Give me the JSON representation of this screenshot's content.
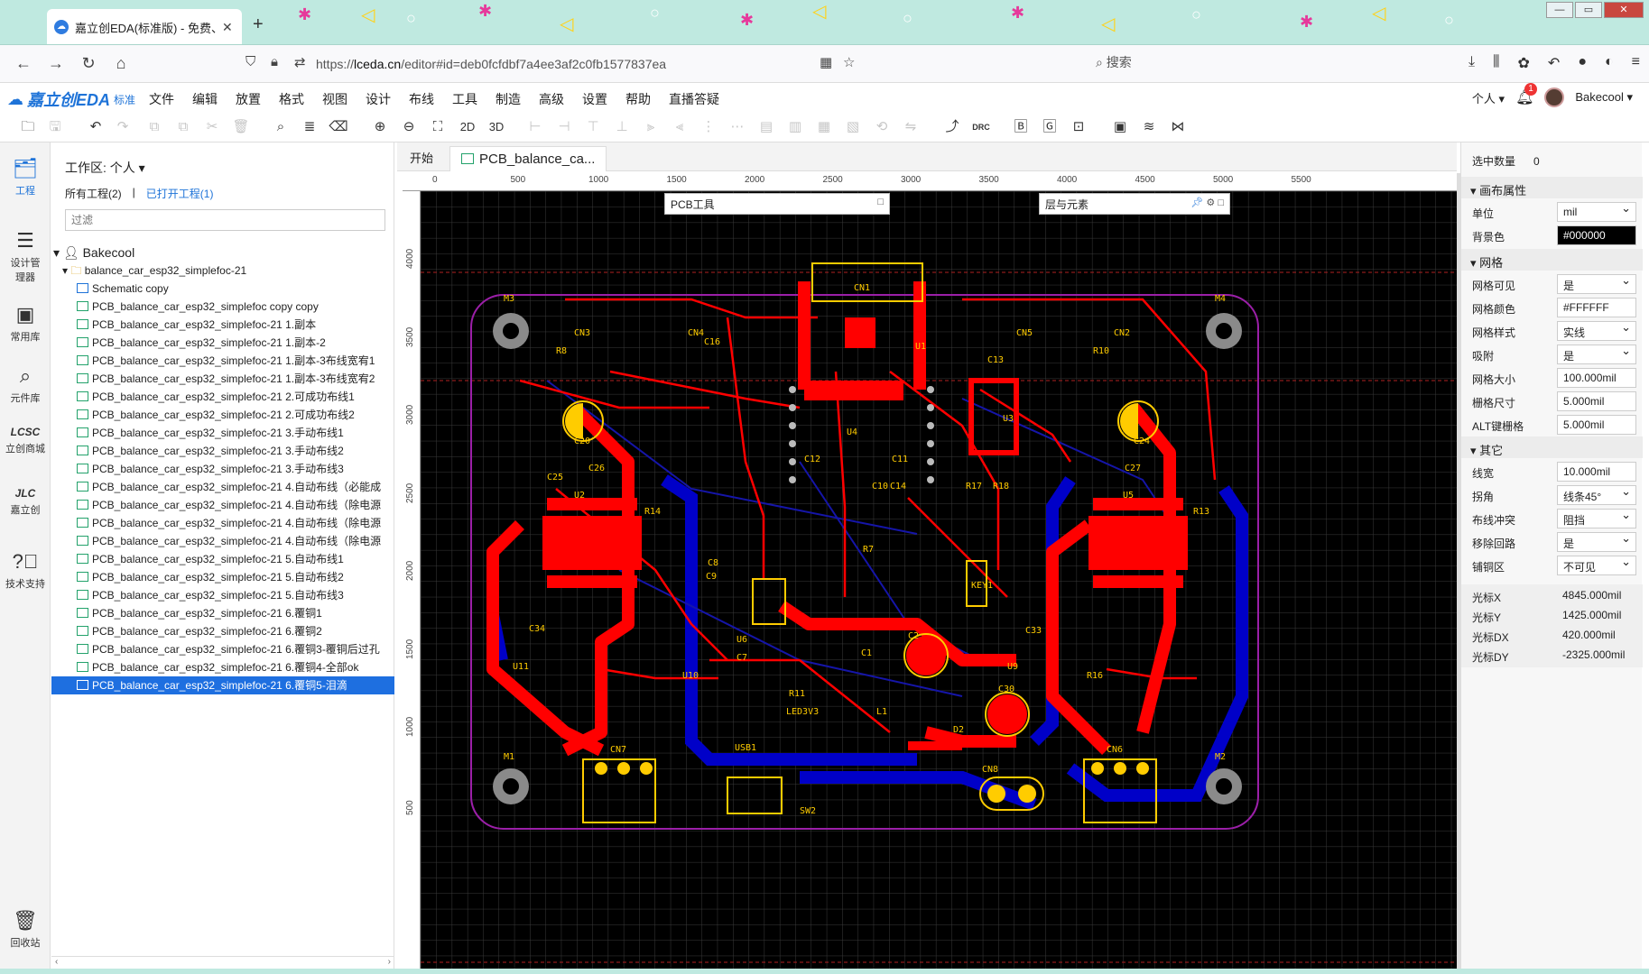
{
  "browser": {
    "tab_title": "嘉立创EDA(标准版) - 免费、易",
    "new_tab": "+",
    "url_prefix": "https://",
    "url_host": "lceda.cn",
    "url_path": "/editor#id=deb0fcfdbf7a4ee3af2c0fb1577837ea",
    "search_placeholder": "搜索",
    "window_controls": [
      "—",
      "▭",
      "✕"
    ]
  },
  "app": {
    "logo_text": "嘉立创EDA",
    "edition": "标准",
    "menus": [
      "文件",
      "编辑",
      "放置",
      "格式",
      "视图",
      "设计",
      "布线",
      "工具",
      "制造",
      "高级",
      "设置",
      "帮助",
      "直播答疑"
    ],
    "user_menu": "个人",
    "notification_count": "1",
    "username": "Bakecool"
  },
  "toolbar": {
    "btn_2d": "2D",
    "btn_3d": "3D",
    "btn_drc": "DRC"
  },
  "iconbar": [
    {
      "label": "工程",
      "icon": "folder-icon"
    },
    {
      "label": "设计管理器",
      "icon": "list-icon"
    },
    {
      "label": "常用库",
      "icon": "chip-icon"
    },
    {
      "label": "元件库",
      "icon": "search-icon"
    },
    {
      "label": "立创商城",
      "icon": "lcsc-icon"
    },
    {
      "label": "嘉立创",
      "icon": "jlc-icon"
    },
    {
      "label": "技术支持",
      "icon": "help-icon"
    },
    {
      "label": "回收站",
      "icon": "trash-icon"
    }
  ],
  "workspace": {
    "title": "工作区: 个人",
    "all_projects": "所有工程(2)",
    "separator": "|",
    "open_projects": "已打开工程(1)",
    "filter_placeholder": "过滤",
    "user": "Bakecool",
    "project": "balance_car_esp32_simplefoc-21",
    "files": [
      "Schematic copy",
      "PCB_balance_car_esp32_simplefoc copy copy",
      "PCB_balance_car_esp32_simplefoc-21 1.副本",
      "PCB_balance_car_esp32_simplefoc-21 1.副本-2",
      "PCB_balance_car_esp32_simplefoc-21 1.副本-3布线宽宥1",
      "PCB_balance_car_esp32_simplefoc-21 1.副本-3布线宽宥2",
      "PCB_balance_car_esp32_simplefoc-21 2.可成功布线1",
      "PCB_balance_car_esp32_simplefoc-21 2.可成功布线2",
      "PCB_balance_car_esp32_simplefoc-21 3.手动布线1",
      "PCB_balance_car_esp32_simplefoc-21 3.手动布线2",
      "PCB_balance_car_esp32_simplefoc-21 3.手动布线3",
      "PCB_balance_car_esp32_simplefoc-21 4.自动布线（必能成",
      "PCB_balance_car_esp32_simplefoc-21 4.自动布线（除电源",
      "PCB_balance_car_esp32_simplefoc-21 4.自动布线（除电源",
      "PCB_balance_car_esp32_simplefoc-21 4.自动布线（除电源",
      "PCB_balance_car_esp32_simplefoc-21 5.自动布线1",
      "PCB_balance_car_esp32_simplefoc-21 5.自动布线2",
      "PCB_balance_car_esp32_simplefoc-21 5.自动布线3",
      "PCB_balance_car_esp32_simplefoc-21 6.覆铜1",
      "PCB_balance_car_esp32_simplefoc-21 6.覆铜2",
      "PCB_balance_car_esp32_simplefoc-21 6.覆铜3-覆铜后过孔",
      "PCB_balance_car_esp32_simplefoc-21 6.覆铜4-全部ok",
      "PCB_balance_car_esp32_simplefoc-21 6.覆铜5-泪滴"
    ],
    "selected_file": "PCB_balance_car_esp32_simplefoc-21 6.覆铜5-泪滴"
  },
  "editor": {
    "tabs": [
      "开始",
      "PCB_balance_ca..."
    ],
    "ruler_top": [
      "0",
      "500",
      "1000",
      "1500",
      "2000",
      "2500",
      "3000",
      "3500",
      "4000",
      "4500",
      "5000",
      "5500"
    ],
    "ruler_left": [
      "4000",
      "3500",
      "3000",
      "2500",
      "2000",
      "1500",
      "1000",
      "500"
    ],
    "pcb_tools_title": "PCB工具",
    "layers_title": "层与元素",
    "designators": [
      "M3",
      "M4",
      "M1",
      "M2",
      "CN1",
      "CN2",
      "CN3",
      "CN4",
      "CN5",
      "CN6",
      "CN7",
      "CN8",
      "U1",
      "U2",
      "U3",
      "U4",
      "U5",
      "U6",
      "U9",
      "U10",
      "U11",
      "C1",
      "C2",
      "C7",
      "C8",
      "C9",
      "C10",
      "C11",
      "C12",
      "C13",
      "C14",
      "C16",
      "C20",
      "C24",
      "C25",
      "C26",
      "C27",
      "C30",
      "C33",
      "C34",
      "R7",
      "R8",
      "R10",
      "R11",
      "R13",
      "R14",
      "R16",
      "R17",
      "R18",
      "KEY1",
      "USB1",
      "SW2",
      "LED3V3",
      "L1",
      "D2"
    ]
  },
  "properties": {
    "selection_label": "选中数量",
    "selection_count": "0",
    "canvas_section": "画布属性",
    "unit_label": "单位",
    "unit_value": "mil",
    "bg_label": "背景色",
    "bg_value": "#000000",
    "grid_section": "网格",
    "grid_visible_label": "网格可见",
    "grid_visible_value": "是",
    "grid_color_label": "网格颜色",
    "grid_color_value": "#FFFFFF",
    "grid_style_label": "网格样式",
    "grid_style_value": "实线",
    "snap_label": "吸附",
    "snap_value": "是",
    "grid_size_label": "网格大小",
    "grid_size_value": "100.000mil",
    "snap_size_label": "栅格尺寸",
    "snap_size_value": "5.000mil",
    "alt_snap_label": "ALT键栅格",
    "alt_snap_value": "5.000mil",
    "other_section": "其它",
    "track_width_label": "线宽",
    "track_width_value": "10.000mil",
    "corner_label": "拐角",
    "corner_value": "线条45°",
    "conflict_label": "布线冲突",
    "conflict_value": "阻挡",
    "remove_loop_label": "移除回路",
    "remove_loop_value": "是",
    "copper_label": "铺铜区",
    "copper_value": "不可见",
    "cursor_x_label": "光标X",
    "cursor_x_value": "4845.000mil",
    "cursor_y_label": "光标Y",
    "cursor_y_value": "1425.000mil",
    "cursor_dx_label": "光标DX",
    "cursor_dx_value": "420.000mil",
    "cursor_dy_label": "光标DY",
    "cursor_dy_value": "-2325.000mil"
  },
  "colors": {
    "accent": "#1e73d8",
    "top_layer": "#ff0000",
    "bottom_layer": "#0000c8",
    "silkscreen": "#ffcc00",
    "board_outline": "#9b1fa8"
  }
}
